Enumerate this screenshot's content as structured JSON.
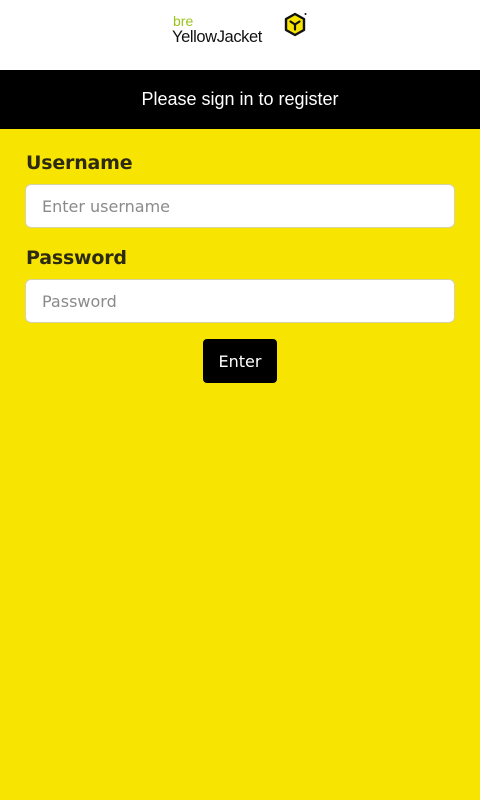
{
  "header": {
    "logo": {
      "prefix": "bre",
      "name": "YellowJacket",
      "icon": "yellowjacket-cube-icon",
      "prefix_color": "#9bc31c"
    }
  },
  "banner": {
    "text": "Please sign in to register"
  },
  "form": {
    "username": {
      "label": "Username",
      "value": "",
      "placeholder": "Enter username"
    },
    "password": {
      "label": "Password",
      "value": "",
      "placeholder": "Password"
    },
    "submit_label": "Enter"
  },
  "colors": {
    "background": "#f7e400",
    "banner": "#000000",
    "button": "#000000"
  }
}
